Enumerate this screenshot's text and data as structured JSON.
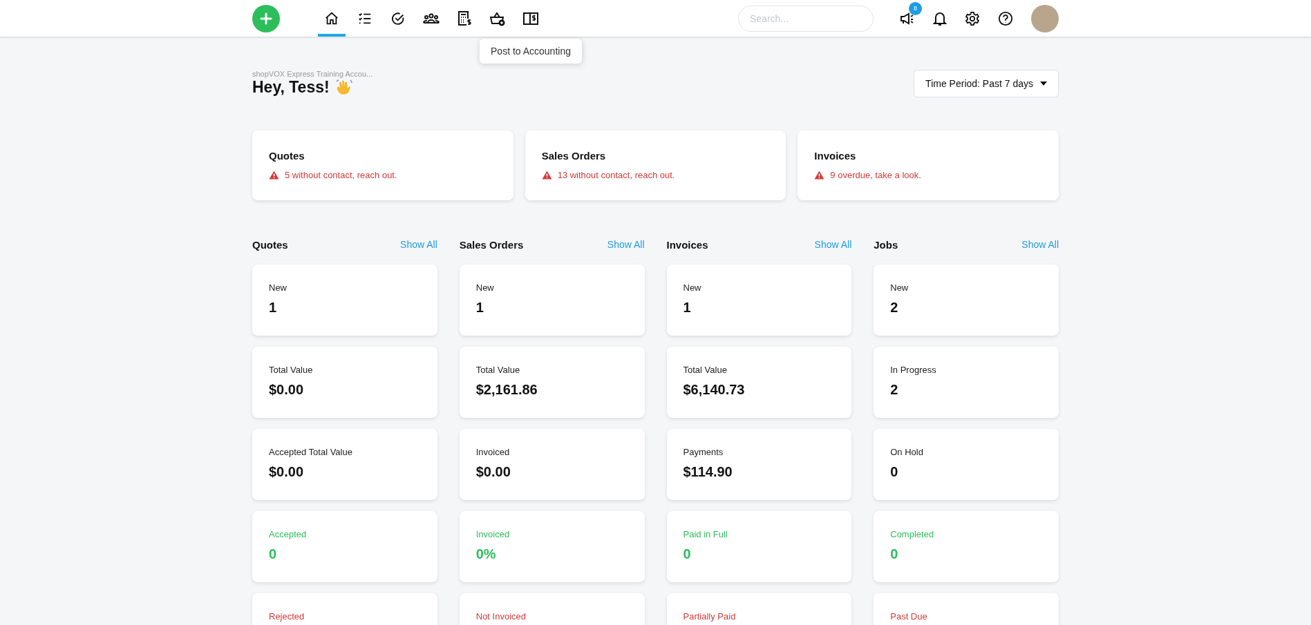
{
  "nav": {
    "items": [
      {
        "selected": true
      },
      {
        "selected": false
      },
      {
        "selected": false
      },
      {
        "selected": false
      },
      {
        "selected": false
      },
      {
        "selected": false
      },
      {
        "selected": false,
        "tooltip": "Post to Accounting"
      }
    ],
    "search": {
      "placeholder": "Search..."
    },
    "announcements_badge": "8"
  },
  "header": {
    "account": "shopVOX Express Training Accou...",
    "greeting": "Hey, Tess!",
    "period_button": "Time Period: Past 7 days"
  },
  "alerts": [
    {
      "title": "Quotes",
      "message": "5 without contact, reach out."
    },
    {
      "title": "Sales Orders",
      "message": "13 without contact, reach out."
    },
    {
      "title": "Invoices",
      "message": "9 overdue, take a look."
    }
  ],
  "columns": [
    {
      "title": "Quotes",
      "link": "Show All",
      "stats": [
        {
          "kind": "plain",
          "label": "New",
          "value": "1"
        },
        {
          "kind": "plain",
          "label": "Total Value",
          "value": "$0.00"
        },
        {
          "kind": "plain",
          "label": "Accepted Total Value",
          "value": "$0.00"
        },
        {
          "kind": "good",
          "label": "Accepted",
          "value": "0"
        },
        {
          "kind": "bad",
          "label": "Rejected"
        }
      ]
    },
    {
      "title": "Sales Orders",
      "link": "Show All",
      "stats": [
        {
          "kind": "plain",
          "label": "New",
          "value": "1"
        },
        {
          "kind": "plain",
          "label": "Total Value",
          "value": "$2,161.86"
        },
        {
          "kind": "plain",
          "label": "Invoiced",
          "value": "$0.00"
        },
        {
          "kind": "good",
          "label": "Invoiced",
          "value": "0%"
        },
        {
          "kind": "bad",
          "label": "Not Invoiced"
        }
      ]
    },
    {
      "title": "Invoices",
      "link": "Show All",
      "stats": [
        {
          "kind": "plain",
          "label": "New",
          "value": "1"
        },
        {
          "kind": "plain",
          "label": "Total Value",
          "value": "$6,140.73"
        },
        {
          "kind": "plain",
          "label": "Payments",
          "value": "$114.90"
        },
        {
          "kind": "good",
          "label": "Paid in Full",
          "value": "0"
        },
        {
          "kind": "bad",
          "label": "Partially Paid"
        }
      ]
    },
    {
      "title": "Jobs",
      "link": "Show All",
      "stats": [
        {
          "kind": "plain",
          "label": "New",
          "value": "2"
        },
        {
          "kind": "plain",
          "label": "In Progress",
          "value": "2"
        },
        {
          "kind": "plain",
          "label": "On Hold",
          "value": "0"
        },
        {
          "kind": "good",
          "label": "Completed",
          "value": "0"
        },
        {
          "kind": "bad",
          "label": "Past Due"
        }
      ]
    }
  ]
}
